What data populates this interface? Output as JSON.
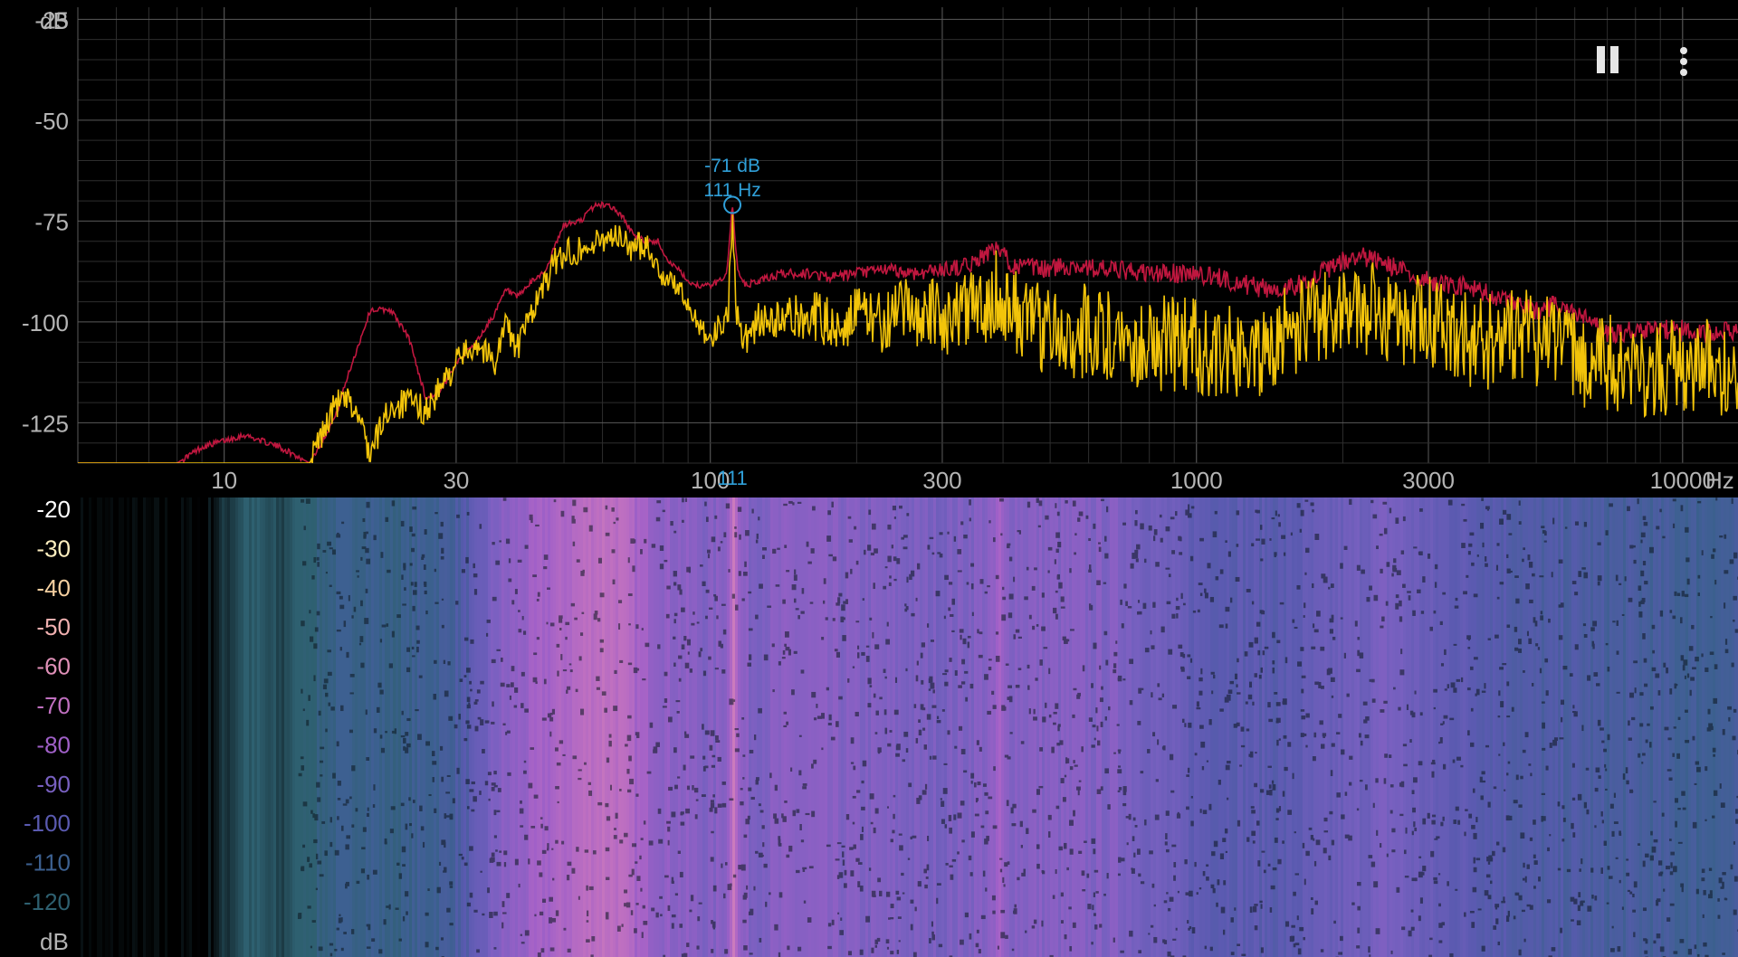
{
  "colors": {
    "background": "#000000",
    "grid": "#5a5a5a",
    "axis_text": "#b4b4b4",
    "peak_hold_trace": "#c0173f",
    "live_trace": "#f2c40a",
    "marker": "#2f9fd8"
  },
  "controls": {
    "pause_icon": "pause-icon",
    "menu_icon": "more-vert-icon"
  },
  "chart_data": [
    {
      "type": "line",
      "xscale": "log",
      "xlim": [
        5,
        13000
      ],
      "ylim": [
        -135,
        -22
      ],
      "yunit": "dB",
      "xunit": "Hz",
      "yticks": [
        "-25",
        "-50",
        "-75",
        "-100",
        "-125"
      ],
      "xticks": [
        "10",
        "30",
        "100",
        "300",
        "1000",
        "3000",
        "10000"
      ],
      "grid": true,
      "marker": {
        "label_db": "-71 dB",
        "label_hz": "111 Hz",
        "x_label": "111",
        "freq": 111,
        "db": -71
      },
      "series": [
        {
          "x": [
            5,
            8,
            9,
            11,
            13,
            15,
            17,
            18,
            20,
            22,
            24,
            26,
            28,
            30,
            33,
            36,
            38,
            40,
            43,
            46,
            48,
            50,
            54,
            58,
            62,
            66,
            70,
            74,
            78,
            82,
            86,
            90,
            95,
            100,
            104,
            108,
            111,
            114,
            118,
            125,
            140,
            160,
            180,
            200,
            230,
            260,
            300,
            340,
            370,
            390,
            420,
            480,
            550,
            650,
            800,
            1000,
            1200,
            1400,
            1600,
            1800,
            2000,
            2200,
            2400,
            2700,
            3000,
            3500,
            4000,
            4500,
            5000,
            5500,
            6000,
            6500,
            7000,
            8000,
            9000,
            10000,
            11000,
            12000,
            13000
          ],
          "y": [
            -135,
            -135,
            -131,
            -128,
            -131,
            -135,
            -123,
            -113,
            -97,
            -97,
            -104,
            -119,
            -117,
            -110,
            -105,
            -98,
            -92,
            -94,
            -90,
            -87,
            -81,
            -76,
            -75,
            -71,
            -71,
            -74,
            -79,
            -80,
            -80,
            -85,
            -87,
            -90,
            -91,
            -91,
            -90,
            -88,
            -71,
            -88,
            -91,
            -90,
            -88,
            -88,
            -89,
            -88,
            -87,
            -88,
            -87,
            -86,
            -83,
            -82,
            -86,
            -87,
            -86,
            -87,
            -88,
            -88,
            -90,
            -92,
            -91,
            -88,
            -85,
            -84,
            -85,
            -88,
            -90,
            -91,
            -93,
            -96,
            -97,
            -96,
            -98,
            -100,
            -103,
            -102,
            -102,
            -102,
            -103,
            -102,
            -103
          ]
        },
        {
          "x": [
            5,
            8,
            10,
            13,
            15,
            16,
            17,
            18,
            19,
            20,
            21,
            22,
            24,
            26,
            28,
            30,
            33,
            36,
            38,
            40,
            43,
            46,
            48,
            50,
            54,
            58,
            62,
            66,
            70,
            74,
            78,
            82,
            86,
            90,
            95,
            100,
            105,
            109,
            111,
            113,
            118,
            125,
            140,
            160,
            180,
            200,
            230,
            260,
            300,
            340,
            370,
            390,
            420,
            480,
            550,
            650,
            800,
            1000,
            1200,
            1400,
            1600,
            1800,
            2000,
            2200,
            2500,
            3000,
            3500,
            4000,
            4500,
            5000,
            5500,
            6000,
            6500,
            7000,
            8000,
            9000,
            10000,
            11000,
            12000,
            13000
          ],
          "y": [
            -135,
            -135,
            -135,
            -135,
            -135,
            -127,
            -120,
            -120,
            -124,
            -133,
            -126,
            -121,
            -120,
            -122,
            -116,
            -110,
            -105,
            -110,
            -100,
            -107,
            -97,
            -90,
            -85,
            -83,
            -82,
            -81,
            -78,
            -80,
            -82,
            -80,
            -87,
            -90,
            -91,
            -97,
            -100,
            -104,
            -101,
            -96,
            -72,
            -98,
            -104,
            -100,
            -100,
            -98,
            -101,
            -98,
            -100,
            -97,
            -99,
            -98,
            -95,
            -92,
            -97,
            -101,
            -102,
            -103,
            -105,
            -106,
            -108,
            -106,
            -101,
            -99,
            -97,
            -96,
            -98,
            -100,
            -104,
            -105,
            -103,
            -104,
            -106,
            -108,
            -112,
            -110,
            -111,
            -112,
            -111,
            -110,
            -112,
            -110
          ]
        }
      ]
    },
    {
      "type": "heatmap",
      "colorbar_ticks": [
        "-20",
        "-30",
        "-40",
        "-50",
        "-60",
        "-70",
        "-80",
        "-90",
        "-100",
        "-110",
        "-120"
      ],
      "colorbar_unit": "dB",
      "colorbar_colors": [
        "#ffffff",
        "#fff0c0",
        "#f5d0a0",
        "#f0b0b0",
        "#e090b8",
        "#c070c0",
        "#a060c8",
        "#7860c0",
        "#5a5ab0",
        "#3c6090",
        "#2e6070"
      ],
      "xscale": "log",
      "xlim": [
        5,
        13000
      ],
      "frequency_intensity_db": {
        "x": [
          5,
          9,
          11,
          13,
          15,
          17,
          18,
          20,
          22,
          25,
          28,
          30,
          33,
          36,
          40,
          45,
          50,
          55,
          60,
          65,
          70,
          80,
          90,
          100,
          108,
          111,
          114,
          120,
          150,
          200,
          300,
          380,
          390,
          400,
          500,
          700,
          1000,
          1500,
          2000,
          2500,
          3000,
          4000,
          5000,
          6000,
          7000,
          8000,
          10000,
          13000
        ],
        "y": [
          -140,
          -140,
          -125,
          -130,
          -118,
          -112,
          -112,
          -110,
          -114,
          -110,
          -108,
          -105,
          -98,
          -88,
          -84,
          -79,
          -76,
          -72,
          -70,
          -72,
          -78,
          -84,
          -86,
          -88,
          -84,
          -64,
          -84,
          -88,
          -86,
          -88,
          -90,
          -86,
          -78,
          -86,
          -87,
          -88,
          -98,
          -100,
          -94,
          -90,
          -96,
          -100,
          -104,
          -104,
          -106,
          -106,
          -108,
          -108
        ]
      }
    }
  ]
}
